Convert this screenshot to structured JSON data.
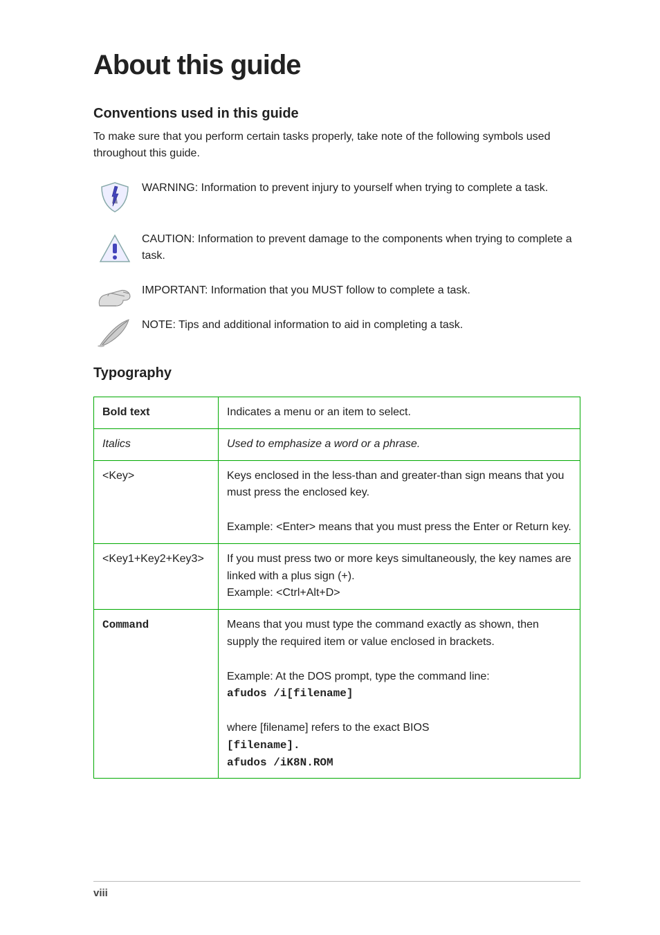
{
  "title": "About this guide",
  "section_conventions_heading": "Conventions used in this guide",
  "section_conventions_text": "To make sure that you perform certain tasks properly, take note of the following symbols used throughout this guide.",
  "conventions": [
    {
      "icon": "shield",
      "name": "WARNING:",
      "text": " Information to prevent injury to yourself when trying to complete a task."
    },
    {
      "icon": "triangle",
      "name": "CAUTION:",
      "text": " Information to prevent damage to the components when trying to complete a task."
    },
    {
      "icon": "hand",
      "name": "IMPORTANT:",
      "text": " Information that you MUST follow to complete a task."
    },
    {
      "icon": "feather",
      "name": "NOTE:",
      "text": " Tips and additional information to aid in completing a task."
    }
  ],
  "typography_heading": "Typography",
  "typo_rows": [
    {
      "left": "Bold text",
      "right": "Indicates a menu or an item to select."
    },
    {
      "left": "Italics",
      "right_em": "Used to emphasize a word or a phrase."
    },
    {
      "left": "<Key>",
      "right": "Keys enclosed in the less-than and greater-than sign means that you must press the enclosed key.",
      "right_example": "Example: <Enter> means that you must press the Enter or Return key."
    },
    {
      "left": "<Key1+Key2+Key3>",
      "right": "If you must press two or more keys simultaneously, the key names are linked with a plus sign (+).",
      "right_example": "Example: <Ctrl+Alt+D>"
    },
    {
      "left_cmd": "Command",
      "right": "Means that you must type the command exactly as shown, then supply the required item or value enclosed in brackets.",
      "right_example_prefix": "Example: At the DOS prompt, type the command line:",
      "cmd1": "afudos /i[filename]",
      "right_example2": "where [filename] refers to the exact BIOS",
      "cmd2": "[filename].",
      "cmd3": "afudos /iK8N.ROM"
    }
  ],
  "footer": "viii"
}
